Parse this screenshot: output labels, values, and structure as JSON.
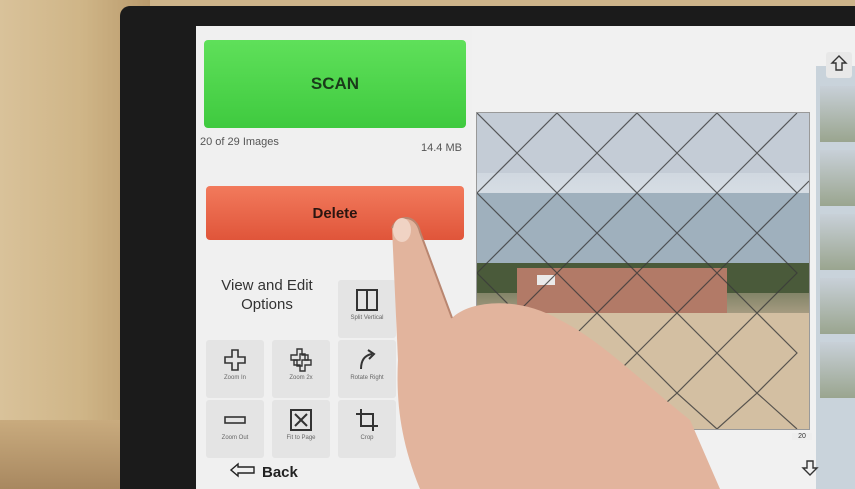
{
  "scan": {
    "label": "SCAN",
    "color": "#4cd44a"
  },
  "status": {
    "image_count": "20 of 29 Images",
    "file_size": "14.4 MB"
  },
  "delete": {
    "label": "Delete",
    "color": "#ea6647"
  },
  "options": {
    "heading_line1": "View and Edit",
    "heading_line2": "Options"
  },
  "tools": [
    {
      "label": "Split Vertical",
      "icon": "split-vertical-icon"
    },
    {
      "label": "Zoom In",
      "icon": "zoom-in-icon"
    },
    {
      "label": "Zoom 2x",
      "icon": "zoom-2x-icon"
    },
    {
      "label": "Rotate Right",
      "icon": "rotate-right-icon"
    },
    {
      "label": "Zoom Out",
      "icon": "zoom-out-icon"
    },
    {
      "label": "Fit to Page",
      "icon": "fit-to-page-icon"
    },
    {
      "label": "Crop",
      "icon": "crop-icon"
    }
  ],
  "back": {
    "label": "Back",
    "icon": "back-arrow-icon"
  },
  "preview": {
    "current_thumb_number": "20"
  }
}
